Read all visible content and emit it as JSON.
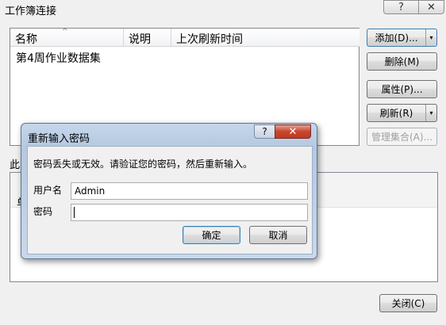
{
  "window": {
    "title": "工作簿连接",
    "help_glyph": "?",
    "close_glyph": "✕"
  },
  "connections": {
    "columns": [
      "名称",
      "说明",
      "上次刷新时间"
    ],
    "sort_indicator": "^",
    "rows": [
      {
        "name": "第4周作业数据集"
      }
    ]
  },
  "side_buttons": {
    "add": "添加(D)...",
    "delete": "删除(M)",
    "properties": "属性(P)...",
    "refresh": "刷新(R)",
    "manage": "管理集合(A)...",
    "dropdown_glyph": "▾"
  },
  "locations_label_partial": "此",
  "locations_row_partial": "单",
  "close_button": "关闭(C)",
  "dialog": {
    "title": "重新输入密码",
    "help_glyph": "?",
    "close_glyph": "✕",
    "message": "密码丢失或无效。请验证您的密码，然后重新输入。",
    "username_label": "用户名",
    "username_value": "Admin",
    "password_label": "密码",
    "password_value": "",
    "ok": "确定",
    "cancel": "取消"
  }
}
